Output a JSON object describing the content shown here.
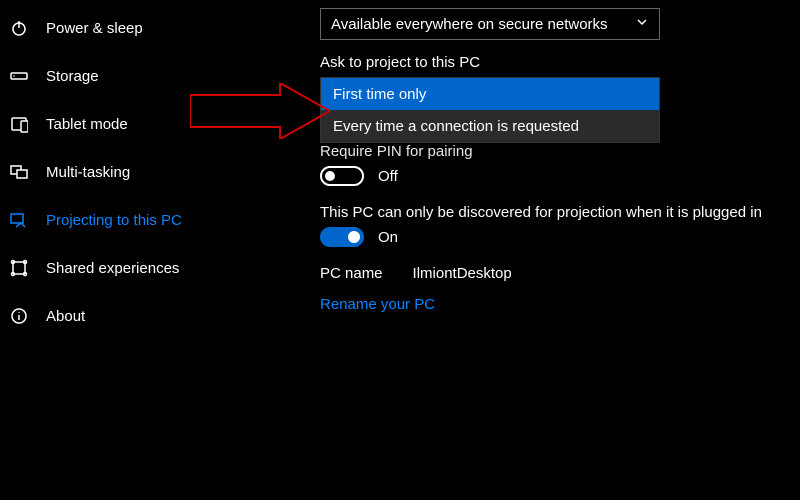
{
  "sidebar": {
    "items": [
      {
        "label": "Power & sleep",
        "icon": "power"
      },
      {
        "label": "Storage",
        "icon": "storage"
      },
      {
        "label": "Tablet mode",
        "icon": "tablet"
      },
      {
        "label": "Multi-tasking",
        "icon": "multitask"
      },
      {
        "label": "Projecting to this PC",
        "icon": "projecting",
        "active": true
      },
      {
        "label": "Shared experiences",
        "icon": "shared"
      },
      {
        "label": "About",
        "icon": "about"
      }
    ]
  },
  "main": {
    "availability_dropdown": {
      "selected": "Available everywhere on secure networks"
    },
    "ask_project": {
      "label": "Ask to project to this PC",
      "options": [
        "First time only",
        "Every time a connection is requested"
      ],
      "selected_index": 0
    },
    "pin_section": {
      "label": "Require PIN for pairing",
      "toggle_state": "Off",
      "toggle_on": false
    },
    "discover_section": {
      "label": "This PC can only be discovered for projection when it is plugged in",
      "toggle_state": "On",
      "toggle_on": true
    },
    "pc_name": {
      "label": "PC name",
      "value": "IlmiontDesktop"
    },
    "rename_link": "Rename your PC"
  }
}
